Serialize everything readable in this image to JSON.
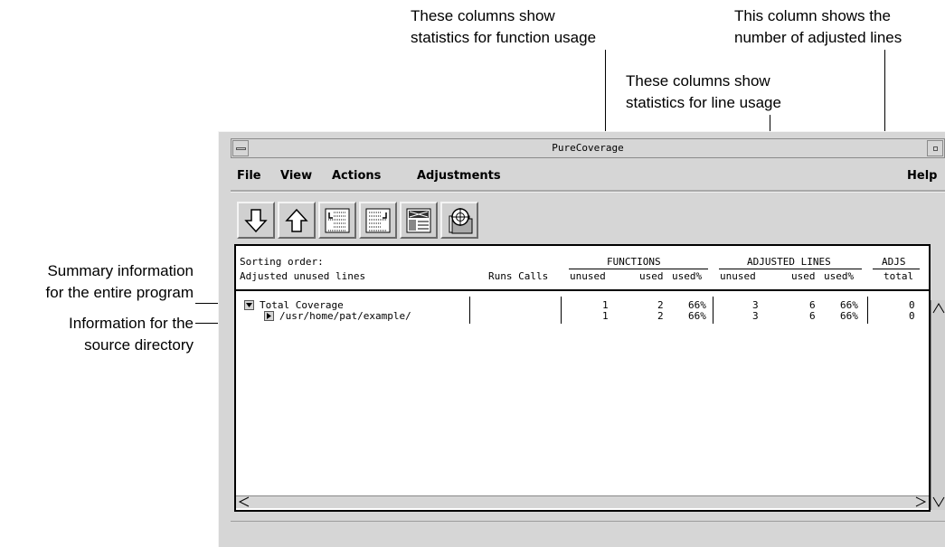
{
  "callouts": {
    "function_usage": [
      "These columns show",
      "statistics for function usage"
    ],
    "adjusted_lines": [
      "This column shows the",
      "number of adjusted lines"
    ],
    "line_usage": [
      "These columns show",
      "statistics for line usage"
    ],
    "summary": [
      "Summary information",
      "for the entire program"
    ],
    "source_dir": [
      "Information for the",
      "source directory"
    ]
  },
  "window": {
    "title": "PureCoverage"
  },
  "menu": {
    "file": "File",
    "view": "View",
    "actions": "Actions",
    "adjustments": "Adjustments",
    "help": "Help"
  },
  "toolbar": [
    {
      "icon": "arrow-down-icon"
    },
    {
      "icon": "arrow-up-icon"
    },
    {
      "icon": "expand-icon"
    },
    {
      "icon": "collapse-icon"
    },
    {
      "icon": "annotate-icon"
    },
    {
      "icon": "target-icon"
    }
  ],
  "table": {
    "sorting_label": "Sorting order:",
    "sorting_value": "Adjusted unused lines",
    "runs_calls": "Runs Calls",
    "functions": "FUNCTIONS",
    "adjusted_lines": "ADJUSTED LINES",
    "adjs": "ADJS",
    "col_unused": "unused",
    "col_used": "used",
    "col_usedpct": "used%",
    "col_unused2": "unused",
    "col_used2": "used",
    "col_usedpct2": "used%",
    "col_total": "total",
    "rows": [
      {
        "name": "Total Coverage",
        "f_unused": "1",
        "f_used": "2",
        "f_pct": "66%",
        "l_unused": "3",
        "l_used": "6",
        "l_pct": "66%",
        "adjs": "0"
      },
      {
        "name": "/usr/home/pat/example/",
        "f_unused": "1",
        "f_used": "2",
        "f_pct": "66%",
        "l_unused": "3",
        "l_used": "6",
        "l_pct": "66%",
        "adjs": "0"
      }
    ]
  }
}
